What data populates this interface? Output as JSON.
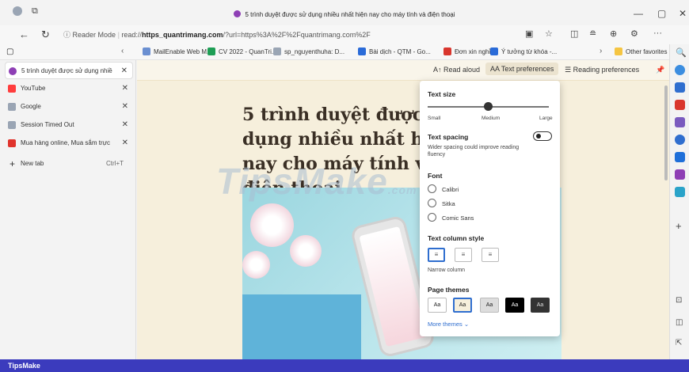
{
  "window": {
    "title": "5 trình duyệt được sử dụng nhiều nhất hiện nay cho máy tính và điện thoại"
  },
  "address": {
    "mode_label": "Reader Mode",
    "url_prefix": "read://",
    "url_host": "https_quantrimang.com",
    "url_rest": "/?url=https%3A%2F%2Fquantrimang.com%2F"
  },
  "favorites": {
    "items": [
      {
        "label": "MailEnable Web M...",
        "color": "#6a8fd1"
      },
      {
        "label": "CV 2022 - QuanTri...",
        "color": "#1e9e55"
      },
      {
        "label": "sp_nguyenthuha: D...",
        "color": "#9aa5b4"
      },
      {
        "label": "Bài dịch - QTM - Go...",
        "color": "#2a6bd8"
      },
      {
        "label": "Đơn xin nghỉ",
        "color": "#d9362d"
      },
      {
        "label": "Ý tưởng từ khóa -...",
        "color": "#2a6bd8"
      }
    ],
    "other_label": "Other favorites"
  },
  "tabs": {
    "items": [
      {
        "label": "5 trình duyệt được sử dụng nhiề",
        "color": "#8e3fb5"
      },
      {
        "label": "YouTube",
        "color": "#ff3d3d"
      },
      {
        "label": "Google",
        "color": "#9aa5b4"
      },
      {
        "label": "Session Timed Out",
        "color": "#9aa5b4"
      },
      {
        "label": "Mua hàng online, Mua sắm trực",
        "color": "#e0332c"
      }
    ],
    "new_tab_label": "New tab",
    "new_tab_shortcut": "Ctrl+T"
  },
  "reader_toolbar": {
    "read_aloud": "Read aloud",
    "text_prefs": "Text preferences",
    "reading_prefs": "Reading preferences"
  },
  "article": {
    "title": "5 trình duyệt được sử dụng nhiều nhất hiện nay cho máy tính và điện thoại",
    "watermark": "TipsMake",
    "watermark_sub": ".com"
  },
  "text_prefs_panel": {
    "text_size": {
      "heading": "Text size",
      "small": "Small",
      "medium": "Medium",
      "large": "Large",
      "level": 0.5
    },
    "text_spacing": {
      "heading": "Text spacing",
      "description": "Wider spacing could improve reading fluency",
      "enabled": false
    },
    "font": {
      "heading": "Font",
      "options": [
        "Calibri",
        "Sitka",
        "Comic Sans"
      ]
    },
    "column": {
      "heading": "Text column style",
      "selected_label": "Narrow column"
    },
    "themes": {
      "heading": "Page themes",
      "more_label": "More themes",
      "swatch_label": "Aa"
    }
  },
  "footer": {
    "brand": "TipsMake"
  }
}
